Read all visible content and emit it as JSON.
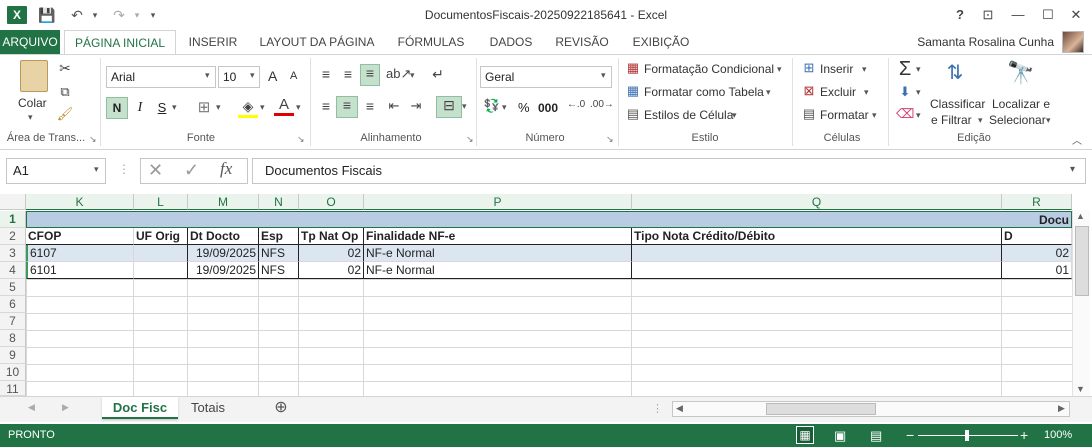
{
  "window": {
    "title": "DocumentosFiscais-20250922185641 - Excel",
    "help": "?",
    "minimize": "—",
    "restore": "☐",
    "close": "✕"
  },
  "tabs": [
    "ARQUIVO",
    "PÁGINA INICIAL",
    "INSERIR",
    "LAYOUT DA PÁGINA",
    "FÓRMULAS",
    "DADOS",
    "REVISÃO",
    "EXIBIÇÃO"
  ],
  "user": "Samanta Rosalina Cunha",
  "ribbon": {
    "clipboard": {
      "paste": "Colar",
      "label": "Área de Trans..."
    },
    "font": {
      "name": "Arial",
      "size": "10",
      "bold": "N",
      "italic": "I",
      "underline": "S",
      "grow": "A",
      "shrink": "A",
      "label": "Fonte"
    },
    "alignment": {
      "label": "Alinhamento"
    },
    "number": {
      "format": "Geral",
      "percent": "%",
      "thousands": "000",
      "label": "Número"
    },
    "styles": {
      "conditional": "Formatação Condicional",
      "table": "Formatar como Tabela",
      "cell": "Estilos de Célula",
      "label": "Estilo"
    },
    "cells": {
      "insert": "Inserir",
      "delete": "Excluir",
      "format": "Formatar",
      "label": "Células"
    },
    "editing": {
      "sort1": "Classificar",
      "sort2": "e Filtrar",
      "find1": "Localizar e",
      "find2": "Selecionar",
      "label": "Edição"
    }
  },
  "formula": {
    "namebox": "A1",
    "fx": "fx",
    "value": "Documentos Fiscais"
  },
  "columns": [
    "K",
    "L",
    "M",
    "N",
    "O",
    "P",
    "Q",
    "R"
  ],
  "rows": [
    "1",
    "2",
    "3",
    "4",
    "5",
    "6",
    "7",
    "8",
    "9",
    "10",
    "11"
  ],
  "row1_text": "Docu",
  "headers": [
    "CFOP",
    "UF Orig",
    "Dt Docto",
    "Esp",
    "Tp Nat Op",
    "Finalidade NF-e",
    "Tipo Nota Crédito/Débito",
    "D"
  ],
  "data": [
    [
      "6107",
      "",
      "19/09/2025",
      "NFS",
      "02",
      "NF-e Normal",
      "",
      "02"
    ],
    [
      "6101",
      "",
      "19/09/2025",
      "NFS",
      "02",
      "NF-e Normal",
      "",
      "01"
    ]
  ],
  "sheets": [
    "Doc Fisc",
    "Totais"
  ],
  "add_sheet": "⊕",
  "status": {
    "ready": "PRONTO",
    "zoom": "100%"
  }
}
